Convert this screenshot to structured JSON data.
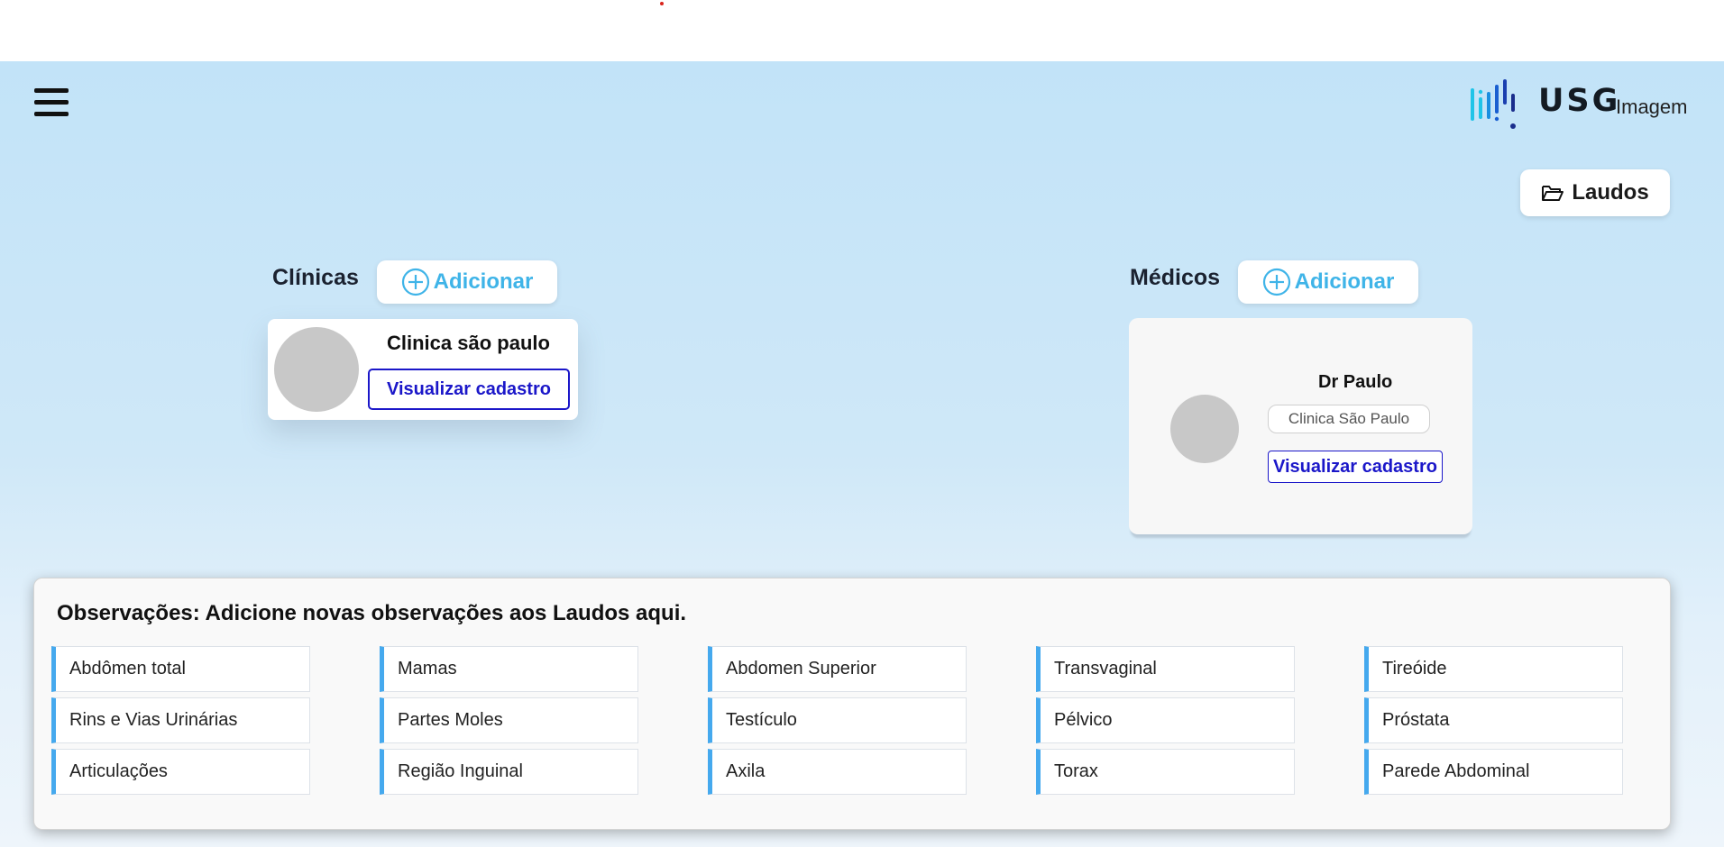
{
  "header": {
    "menu_icon": "hamburger-menu-icon",
    "logo": {
      "brand": "USG",
      "sub": "Imagem",
      "colors": [
        "#1fc4e8",
        "#1a5fd0",
        "#1a2d8c"
      ]
    }
  },
  "laudos_button": {
    "label": "Laudos",
    "icon": "folder-open-icon"
  },
  "clinicas": {
    "title": "Clínicas",
    "add_label": "Adicionar",
    "add_icon": "plus-circle-icon",
    "cards": [
      {
        "name": "Clinica são paulo",
        "view_label": "Visualizar cadastro"
      }
    ]
  },
  "medicos": {
    "title": "Médicos",
    "add_label": "Adicionar",
    "add_icon": "plus-circle-icon",
    "cards": [
      {
        "name": "Dr Paulo",
        "clinic": "Clinica São Paulo",
        "view_label": "Visualizar cadastro"
      }
    ]
  },
  "observacoes": {
    "title": "Observações: Adicione novas observações aos Laudos aqui.",
    "items": [
      [
        "Abdômen total",
        "Mamas",
        "Abdomen Superior",
        "Transvaginal",
        "Tireóide"
      ],
      [
        "Rins e Vias Urinárias",
        "Partes Moles",
        "Testículo",
        "Pélvico",
        "Próstata"
      ],
      [
        "Articulações",
        "Região Inguinal",
        "Axila",
        "Torax",
        "Parede Abdominal"
      ]
    ]
  },
  "colors": {
    "accent": "#3fb4e8",
    "link_blue": "#1b17c9",
    "item_border": "#45a9ee",
    "background_top": "#c2e3f8"
  }
}
